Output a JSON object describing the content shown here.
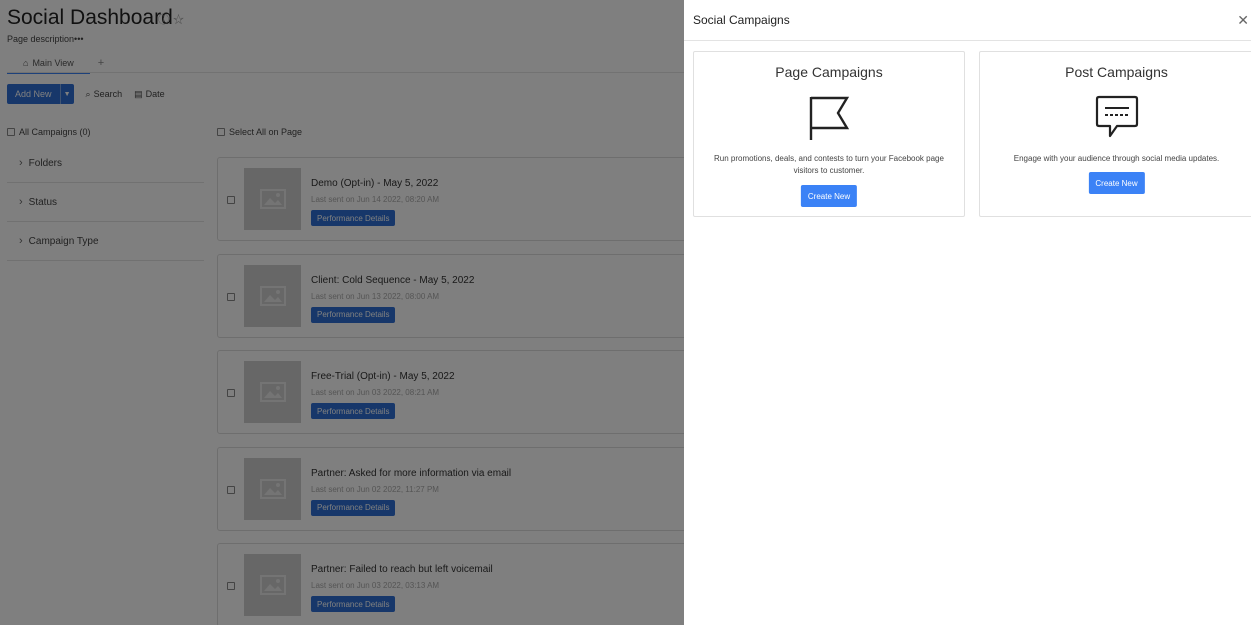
{
  "header": {
    "title": "Social Dashboard",
    "description": "Page description•••",
    "tabs": [
      {
        "label": "Main View",
        "icon": "home-icon"
      }
    ],
    "add_tab": "+"
  },
  "toolbar": {
    "add_new": "Add New",
    "search": "Search",
    "date": "Date"
  },
  "sidebar": {
    "all_campaigns": "All Campaigns (0)",
    "filters": [
      "Folders",
      "Status",
      "Campaign Type"
    ]
  },
  "list": {
    "select_all": "Select All on Page",
    "campaigns": [
      {
        "title": "Demo (Opt-in) - May 5, 2022",
        "last_sent": "Last sent on Jun 14 2022, 08:20 AM",
        "action": "Performance Details"
      },
      {
        "title": "Client: Cold Sequence - May 5, 2022",
        "last_sent": "Last sent on Jun 13 2022, 08:00 AM",
        "action": "Performance Details"
      },
      {
        "title": "Free-Trial (Opt-in) - May 5, 2022",
        "last_sent": "Last sent on Jun 03 2022, 08:21 AM",
        "action": "Performance Details"
      },
      {
        "title": "Partner: Asked for more information via email",
        "last_sent": "Last sent on Jun 02 2022, 11:27 PM",
        "action": "Performance Details"
      },
      {
        "title": "Partner: Failed to reach but left voicemail",
        "last_sent": "Last sent on Jun 03 2022, 03:13 AM",
        "action": "Performance Details"
      }
    ]
  },
  "panel": {
    "title": "Social Campaigns",
    "page_campaigns": {
      "title": "Page Campaigns",
      "description": "Run promotions, deals, and contests to turn your Facebook page visitors to customer.",
      "button": "Create New",
      "icon": "flag-icon"
    },
    "post_campaigns": {
      "title": "Post Campaigns",
      "description": "Engage with your audience through social media updates.",
      "button": "Create New",
      "icon": "message-icon"
    }
  },
  "colors": {
    "primary": "#3b82f6",
    "button_dark": "#2e6fd4",
    "overlay": "rgba(0,0,0,0.5)"
  }
}
